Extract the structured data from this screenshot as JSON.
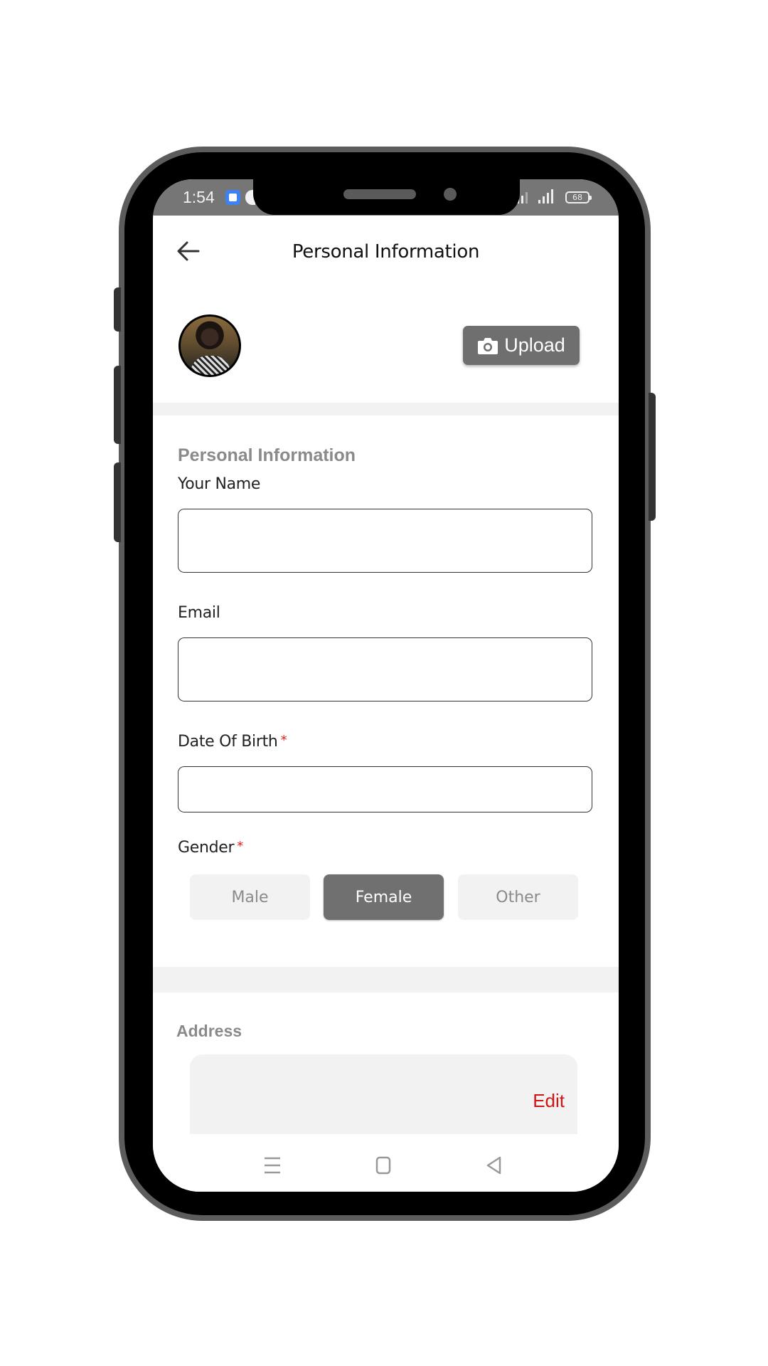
{
  "status_bar": {
    "time": "1:54",
    "battery": "68",
    "icons": [
      "app-notification-icon",
      "signal-icon",
      "signal-icon",
      "battery-icon"
    ]
  },
  "header": {
    "title": "Personal Information",
    "back_icon": "arrow-left-icon"
  },
  "profile": {
    "avatar_alt": "profile-photo",
    "upload_label": "Upload",
    "upload_icon": "camera-icon"
  },
  "form": {
    "section_title": "Personal Information",
    "fields": {
      "name": {
        "label": "Your Name",
        "value": "",
        "required": false
      },
      "email": {
        "label": "Email",
        "value": "",
        "required": false
      },
      "dob": {
        "label": "Date Of Birth",
        "value": "",
        "required": true,
        "required_mark": "*"
      }
    },
    "gender": {
      "label": "Gender",
      "required_mark": "*",
      "options": [
        "Male",
        "Female",
        "Other"
      ],
      "selected": "Female"
    }
  },
  "address": {
    "section_title": "Address",
    "edit_label": "Edit"
  },
  "nav_bar": {
    "buttons": [
      "menu-icon",
      "home-icon",
      "back-icon"
    ]
  },
  "colors": {
    "accent_red": "#d31414",
    "selected_gray": "#707070",
    "section_gray": "#8a8a8a",
    "separator": "#f2f2f2",
    "status_bar": "#767676"
  }
}
